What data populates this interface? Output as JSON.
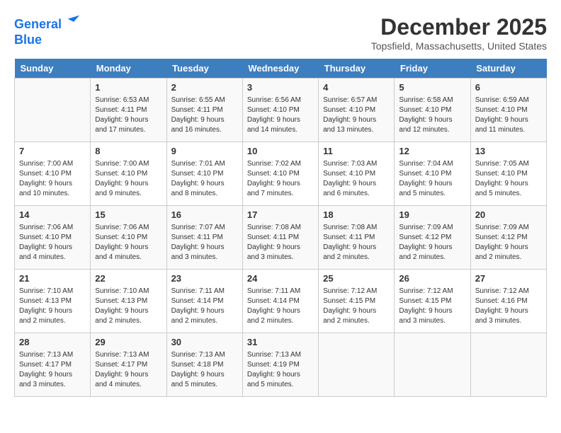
{
  "header": {
    "logo_line1": "General",
    "logo_line2": "Blue",
    "month": "December 2025",
    "location": "Topsfield, Massachusetts, United States"
  },
  "weekdays": [
    "Sunday",
    "Monday",
    "Tuesday",
    "Wednesday",
    "Thursday",
    "Friday",
    "Saturday"
  ],
  "weeks": [
    [
      {
        "day": "",
        "info": ""
      },
      {
        "day": "1",
        "info": "Sunrise: 6:53 AM\nSunset: 4:11 PM\nDaylight: 9 hours\nand 17 minutes."
      },
      {
        "day": "2",
        "info": "Sunrise: 6:55 AM\nSunset: 4:11 PM\nDaylight: 9 hours\nand 16 minutes."
      },
      {
        "day": "3",
        "info": "Sunrise: 6:56 AM\nSunset: 4:10 PM\nDaylight: 9 hours\nand 14 minutes."
      },
      {
        "day": "4",
        "info": "Sunrise: 6:57 AM\nSunset: 4:10 PM\nDaylight: 9 hours\nand 13 minutes."
      },
      {
        "day": "5",
        "info": "Sunrise: 6:58 AM\nSunset: 4:10 PM\nDaylight: 9 hours\nand 12 minutes."
      },
      {
        "day": "6",
        "info": "Sunrise: 6:59 AM\nSunset: 4:10 PM\nDaylight: 9 hours\nand 11 minutes."
      }
    ],
    [
      {
        "day": "7",
        "info": "Sunrise: 7:00 AM\nSunset: 4:10 PM\nDaylight: 9 hours\nand 10 minutes."
      },
      {
        "day": "8",
        "info": "Sunrise: 7:00 AM\nSunset: 4:10 PM\nDaylight: 9 hours\nand 9 minutes."
      },
      {
        "day": "9",
        "info": "Sunrise: 7:01 AM\nSunset: 4:10 PM\nDaylight: 9 hours\nand 8 minutes."
      },
      {
        "day": "10",
        "info": "Sunrise: 7:02 AM\nSunset: 4:10 PM\nDaylight: 9 hours\nand 7 minutes."
      },
      {
        "day": "11",
        "info": "Sunrise: 7:03 AM\nSunset: 4:10 PM\nDaylight: 9 hours\nand 6 minutes."
      },
      {
        "day": "12",
        "info": "Sunrise: 7:04 AM\nSunset: 4:10 PM\nDaylight: 9 hours\nand 5 minutes."
      },
      {
        "day": "13",
        "info": "Sunrise: 7:05 AM\nSunset: 4:10 PM\nDaylight: 9 hours\nand 5 minutes."
      }
    ],
    [
      {
        "day": "14",
        "info": "Sunrise: 7:06 AM\nSunset: 4:10 PM\nDaylight: 9 hours\nand 4 minutes."
      },
      {
        "day": "15",
        "info": "Sunrise: 7:06 AM\nSunset: 4:10 PM\nDaylight: 9 hours\nand 4 minutes."
      },
      {
        "day": "16",
        "info": "Sunrise: 7:07 AM\nSunset: 4:11 PM\nDaylight: 9 hours\nand 3 minutes."
      },
      {
        "day": "17",
        "info": "Sunrise: 7:08 AM\nSunset: 4:11 PM\nDaylight: 9 hours\nand 3 minutes."
      },
      {
        "day": "18",
        "info": "Sunrise: 7:08 AM\nSunset: 4:11 PM\nDaylight: 9 hours\nand 2 minutes."
      },
      {
        "day": "19",
        "info": "Sunrise: 7:09 AM\nSunset: 4:12 PM\nDaylight: 9 hours\nand 2 minutes."
      },
      {
        "day": "20",
        "info": "Sunrise: 7:09 AM\nSunset: 4:12 PM\nDaylight: 9 hours\nand 2 minutes."
      }
    ],
    [
      {
        "day": "21",
        "info": "Sunrise: 7:10 AM\nSunset: 4:13 PM\nDaylight: 9 hours\nand 2 minutes."
      },
      {
        "day": "22",
        "info": "Sunrise: 7:10 AM\nSunset: 4:13 PM\nDaylight: 9 hours\nand 2 minutes."
      },
      {
        "day": "23",
        "info": "Sunrise: 7:11 AM\nSunset: 4:14 PM\nDaylight: 9 hours\nand 2 minutes."
      },
      {
        "day": "24",
        "info": "Sunrise: 7:11 AM\nSunset: 4:14 PM\nDaylight: 9 hours\nand 2 minutes."
      },
      {
        "day": "25",
        "info": "Sunrise: 7:12 AM\nSunset: 4:15 PM\nDaylight: 9 hours\nand 2 minutes."
      },
      {
        "day": "26",
        "info": "Sunrise: 7:12 AM\nSunset: 4:15 PM\nDaylight: 9 hours\nand 3 minutes."
      },
      {
        "day": "27",
        "info": "Sunrise: 7:12 AM\nSunset: 4:16 PM\nDaylight: 9 hours\nand 3 minutes."
      }
    ],
    [
      {
        "day": "28",
        "info": "Sunrise: 7:13 AM\nSunset: 4:17 PM\nDaylight: 9 hours\nand 3 minutes."
      },
      {
        "day": "29",
        "info": "Sunrise: 7:13 AM\nSunset: 4:17 PM\nDaylight: 9 hours\nand 4 minutes."
      },
      {
        "day": "30",
        "info": "Sunrise: 7:13 AM\nSunset: 4:18 PM\nDaylight: 9 hours\nand 5 minutes."
      },
      {
        "day": "31",
        "info": "Sunrise: 7:13 AM\nSunset: 4:19 PM\nDaylight: 9 hours\nand 5 minutes."
      },
      {
        "day": "",
        "info": ""
      },
      {
        "day": "",
        "info": ""
      },
      {
        "day": "",
        "info": ""
      }
    ]
  ]
}
